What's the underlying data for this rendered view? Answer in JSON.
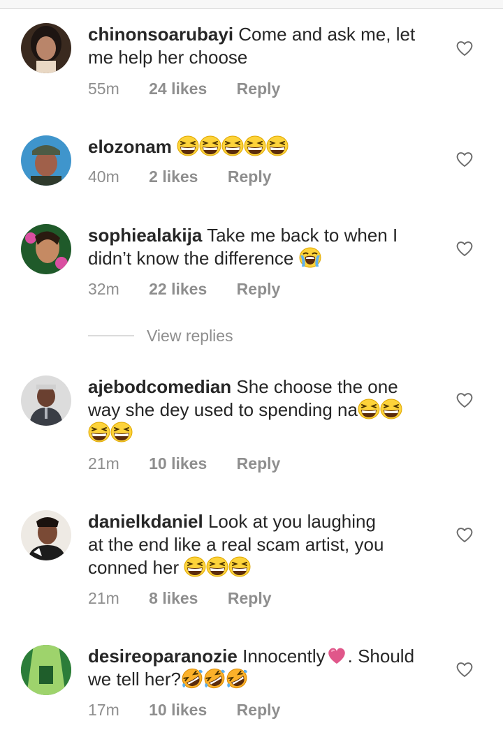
{
  "icons": {
    "like": "heart-outline-icon",
    "laugh": "grinning-squinting-face-emoji",
    "cry": "loudly-crying-face-emoji",
    "rofl": "rolling-on-floor-laughing-emoji",
    "love": "pink-heart-emoji"
  },
  "colors": {
    "text": "#262626",
    "secondary": "#8e8e8e",
    "emoji_yellow": "#fdd33a",
    "heart_pink": "#e0578a"
  },
  "view_replies": "View replies",
  "comments": [
    {
      "username": "chinonsoarubayi",
      "text_1": "Come and ask me, let",
      "text_2": "me help her choose",
      "time": "55m",
      "likes": "24 likes",
      "reply": "Reply"
    },
    {
      "username": "elozonam",
      "time": "40m",
      "likes": "2 likes",
      "reply": "Reply"
    },
    {
      "username": "sophiealakija",
      "text_1": "Take me back to when I",
      "text_2": "didn’t know the difference",
      "time": "32m",
      "likes": "22 likes",
      "reply": "Reply"
    },
    {
      "username": "ajebodcomedian",
      "text_1": "She choose the one",
      "text_2": "way she dey used to spending na",
      "time": "21m",
      "likes": "10 likes",
      "reply": "Reply"
    },
    {
      "username": "danielkdaniel",
      "text_1": "Look at you laughing",
      "text_2": "at the end like a real scam artist, you",
      "text_3": "conned her",
      "time": "21m",
      "likes": "8 likes",
      "reply": "Reply"
    },
    {
      "username": "desireoparanozie",
      "text_1": "Innocently",
      "text_2": ". Should",
      "text_3": "we tell her?",
      "time": "17m",
      "likes": "10 likes",
      "reply": "Reply"
    }
  ]
}
